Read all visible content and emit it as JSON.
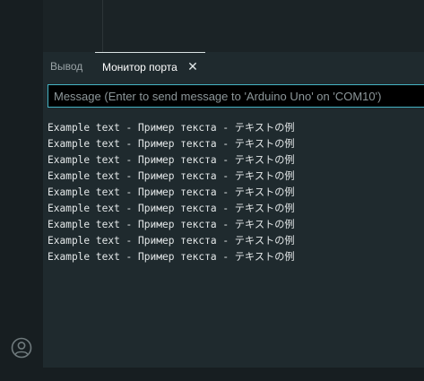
{
  "sidebar": {
    "account_icon": "account-circle-icon"
  },
  "panel": {
    "tabs": [
      {
        "label": "Вывод",
        "active": false
      },
      {
        "label": "Монитор порта",
        "active": true,
        "closable": true
      }
    ],
    "close_glyph": "✕",
    "message_input": {
      "placeholder": "Message (Enter to send message to 'Arduino Uno' on 'COM10')",
      "value": ""
    },
    "output_lines": [
      "Example text - Пример текста - テキストの例",
      "Example text - Пример текста - テキストの例",
      "Example text - Пример текста - テキストの例",
      "Example text - Пример текста - テキストの例",
      "Example text - Пример текста - テキストの例",
      "Example text - Пример текста - テキストの例",
      "Example text - Пример текста - テキストの例",
      "Example text - Пример текста - テキストの例",
      "Example text - Пример текста - テキストの例"
    ]
  },
  "colors": {
    "background": "#171e21",
    "panel": "#1f2a2e",
    "input_border": "#45b3c4",
    "text": "#e3e7e8"
  }
}
